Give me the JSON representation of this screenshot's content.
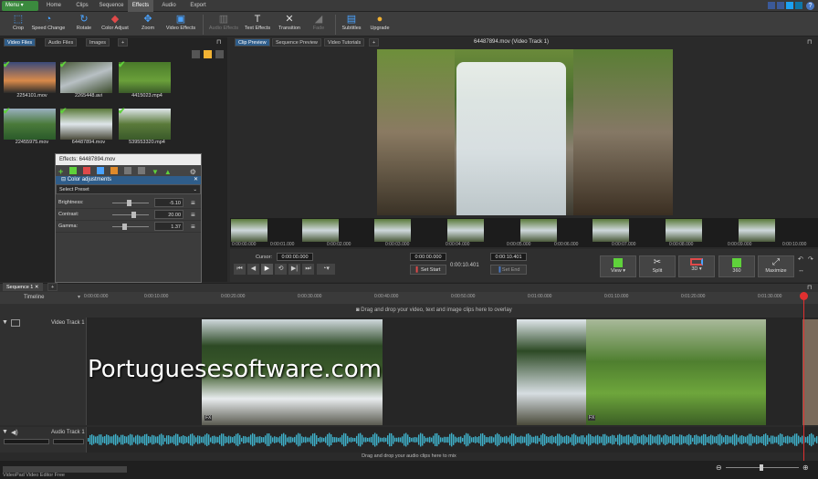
{
  "app": {
    "status": "VideoPad Video Editor Free"
  },
  "menu": {
    "menu_label": "Menu",
    "tabs": [
      "Home",
      "Clips",
      "Sequence",
      "Effects",
      "Audio",
      "Export"
    ],
    "active_tab": "Effects"
  },
  "toolbar": {
    "tools": [
      {
        "label": "Crop",
        "icon": "crop-icon",
        "disabled": false
      },
      {
        "label": "Speed Change",
        "icon": "speed-icon",
        "disabled": false
      },
      {
        "label": "Rotate",
        "icon": "rotate-icon",
        "disabled": false
      },
      {
        "label": "Color Adjust",
        "icon": "color-adjust-icon",
        "disabled": false
      },
      {
        "label": "Zoom",
        "icon": "zoom-icon",
        "disabled": false
      },
      {
        "label": "Video Effects",
        "icon": "video-effects-icon",
        "disabled": false
      },
      {
        "label": "Audio Effects",
        "icon": "audio-effects-icon",
        "disabled": true
      },
      {
        "label": "Text Effects",
        "icon": "text-effects-icon",
        "disabled": false
      },
      {
        "label": "Transition",
        "icon": "transition-icon",
        "disabled": false
      },
      {
        "label": "Fade",
        "icon": "fade-icon",
        "disabled": true
      },
      {
        "label": "Subtitles",
        "icon": "subtitles-icon",
        "disabled": false
      },
      {
        "label": "Upgrade",
        "icon": "upgrade-icon",
        "disabled": false
      }
    ]
  },
  "bin": {
    "tabs": [
      "Video Files",
      "Audio Files",
      "Images"
    ],
    "active_tab": "Video Files",
    "files": [
      {
        "name": "2254101.mov"
      },
      {
        "name": "2265448.avi"
      },
      {
        "name": "4415023.mp4"
      },
      {
        "name": "22455975.mov"
      },
      {
        "name": "64487894.mov"
      },
      {
        "name": "539553320.mp4"
      }
    ]
  },
  "effects_panel": {
    "title": "Effects: 64487894.mov",
    "section": "Color adjustments",
    "preset": "Select Preset",
    "sliders": [
      {
        "label": "Brightness:",
        "value": "-5.10",
        "level": 0.45
      },
      {
        "label": "Contrast:",
        "value": "20.00",
        "level": 0.6
      },
      {
        "label": "Gamma:",
        "value": "1.37",
        "level": 0.3
      }
    ]
  },
  "preview": {
    "tabs": [
      "Clip Preview",
      "Sequence Preview",
      "Video Tutorials"
    ],
    "active_tab": "Clip Preview",
    "title": "64487894.mov (Video Track 1)",
    "ticks": [
      "0:00:00.000",
      "0:00:01.000",
      "0:00:02.000",
      "0:00:03.000",
      "0:00:04.000",
      "0:00:05.000",
      "0:00:06.000",
      "0:00:07.000",
      "0:00:08.000",
      "0:00:09.000",
      "0:00:10.000"
    ],
    "cursor_label": "Cursor:",
    "cursor_value": "0:00:00.000",
    "start_value": "0:00:00.000",
    "duration": "0:00:10.401",
    "end_value": "0:00:10.401",
    "set_start": "Set Start",
    "set_end": "Set End",
    "buttons": {
      "view": "View",
      "split": "Split",
      "three_d": "3D",
      "three_sixty": "360",
      "maximize": "Maximize"
    }
  },
  "timeline": {
    "sequence_tab": "Sequence 1",
    "label": "Timeline",
    "ticks": [
      "0:00:00.000",
      "0:00:10.000",
      "0:00:20.000",
      "0:00:30.000",
      "0:00:40.000",
      "0:00:50.000",
      "0:01:00.000",
      "0:01:10.000",
      "0:01:20.000",
      "0:01:30.000"
    ],
    "overlay_hint": "Drag and drop your video, text and image clips here to overlay",
    "video_track": "Video Track 1",
    "audio_track": "Audio Track 1",
    "audio_hint": "Drag and drop your audio clips here to mix",
    "watermark": "Portuguesesoftware.com"
  }
}
